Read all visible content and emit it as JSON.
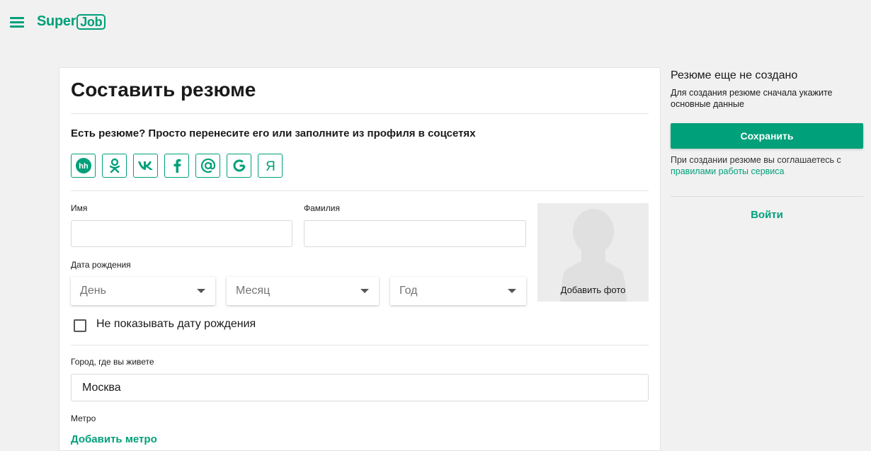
{
  "header": {
    "logo_text": "Super",
    "logo_job": "Job",
    "brand_color": "#00a07a"
  },
  "form": {
    "title": "Составить резюме",
    "import_text": "Есть резюме? Просто перенесите его или заполните из профиля в соцсетях",
    "socials": [
      {
        "name": "hh-icon",
        "label": "hh"
      },
      {
        "name": "odnoklassniki-icon",
        "label": ""
      },
      {
        "name": "vk-icon",
        "label": ""
      },
      {
        "name": "facebook-icon",
        "label": "f"
      },
      {
        "name": "mail-icon",
        "label": "@"
      },
      {
        "name": "google-icon",
        "label": "G"
      },
      {
        "name": "yandex-icon",
        "label": "Я"
      }
    ],
    "first_name_label": "Имя",
    "first_name_value": "",
    "last_name_label": "Фамилия",
    "last_name_value": "",
    "birthdate_label": "Дата рождения",
    "day_placeholder": "День",
    "month_placeholder": "Месяц",
    "year_placeholder": "Год",
    "add_photo": "Добавить фото",
    "hide_birthdate": "Не показывать дату рождения",
    "city_label": "Город, где вы живете",
    "city_value": "Москва",
    "metro_label": "Метро",
    "add_metro": "Добавить метро"
  },
  "sidebar": {
    "title": "Резюме еще не создано",
    "description": "Для создания резюме сначала укажите основные данные",
    "save_button": "Сохранить",
    "agree_text": "При создании резюме вы соглашаетесь с",
    "agree_link": "правилами работы сервиса",
    "login": "Войти"
  }
}
